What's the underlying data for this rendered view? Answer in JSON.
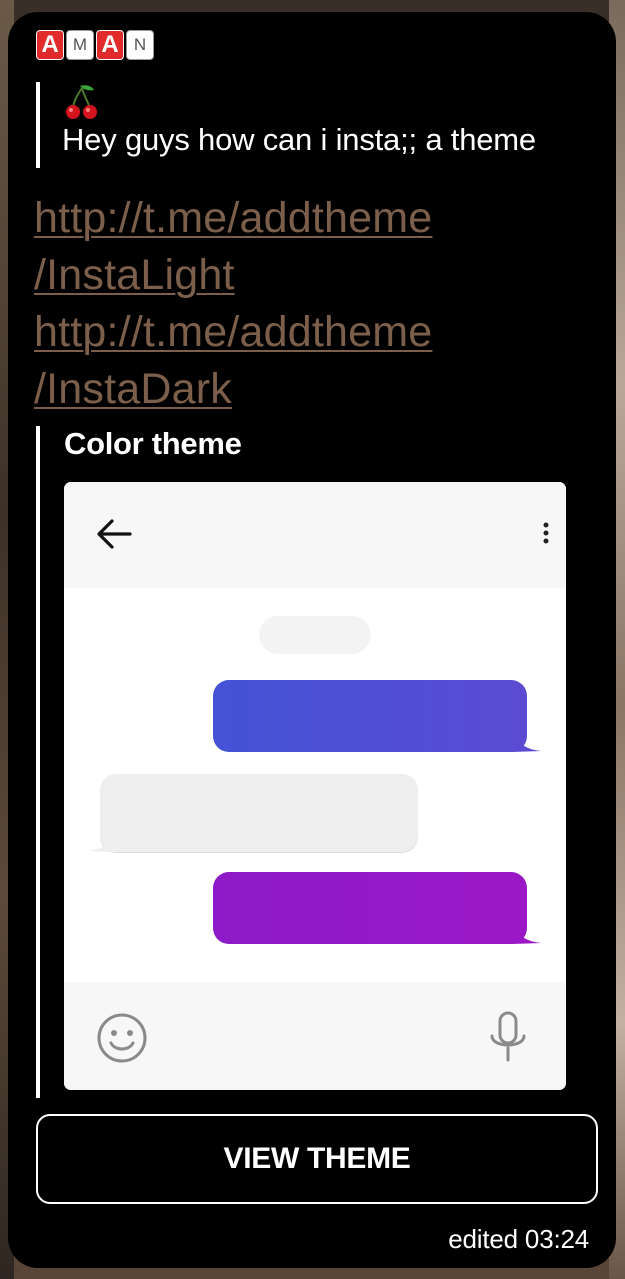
{
  "sender": {
    "letters": [
      {
        "char": "A",
        "style": "red"
      },
      {
        "char": "M",
        "style": "white"
      },
      {
        "char": "A",
        "style": "red"
      },
      {
        "char": "N",
        "style": "white"
      }
    ]
  },
  "reply": {
    "emoji": "cherry-icon",
    "text": "Hey guys how can i insta;; a theme"
  },
  "links": [
    {
      "line1": "http://t.me/addtheme",
      "line2": "/InstaLight"
    },
    {
      "line1": "http://t.me/addtheme",
      "line2": "/InstaDark"
    }
  ],
  "theme_preview": {
    "title": "Color theme",
    "outgoing_color_1": "#4c50d5",
    "incoming_color": "#eeeeee",
    "outgoing_color_2": "#931ac7"
  },
  "button": {
    "label": "VIEW THEME"
  },
  "meta": {
    "status": "edited 03:24"
  },
  "colors": {
    "link": "#7c5f4b",
    "bubble_bg": "#000000",
    "text": "#ffffff"
  }
}
